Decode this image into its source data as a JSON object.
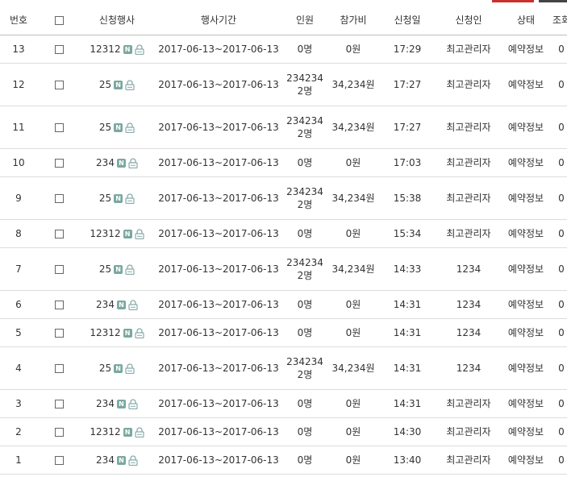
{
  "headers": [
    "번호",
    "",
    "신청행사",
    "행사기간",
    "인원",
    "참가비",
    "신청일",
    "신청인",
    "상태",
    "조회"
  ],
  "rows": [
    {
      "no": "13",
      "event": "12312",
      "period": "2017-06-13~2017-06-13",
      "people": "0명",
      "fee": "0원",
      "date": "17:29",
      "applicant": "최고관리자",
      "status": "예약정보",
      "views": "0"
    },
    {
      "no": "12",
      "event": "25",
      "period": "2017-06-13~2017-06-13",
      "people": "2342342명",
      "fee": "34,234원",
      "date": "17:27",
      "applicant": "최고관리자",
      "status": "예약정보",
      "views": "0"
    },
    {
      "no": "11",
      "event": "25",
      "period": "2017-06-13~2017-06-13",
      "people": "2342342명",
      "fee": "34,234원",
      "date": "17:27",
      "applicant": "최고관리자",
      "status": "예약정보",
      "views": "0"
    },
    {
      "no": "10",
      "event": "234",
      "period": "2017-06-13~2017-06-13",
      "people": "0명",
      "fee": "0원",
      "date": "17:03",
      "applicant": "최고관리자",
      "status": "예약정보",
      "views": "0"
    },
    {
      "no": "9",
      "event": "25",
      "period": "2017-06-13~2017-06-13",
      "people": "2342342명",
      "fee": "34,234원",
      "date": "15:38",
      "applicant": "최고관리자",
      "status": "예약정보",
      "views": "0"
    },
    {
      "no": "8",
      "event": "12312",
      "period": "2017-06-13~2017-06-13",
      "people": "0명",
      "fee": "0원",
      "date": "15:34",
      "applicant": "최고관리자",
      "status": "예약정보",
      "views": "0"
    },
    {
      "no": "7",
      "event": "25",
      "period": "2017-06-13~2017-06-13",
      "people": "2342342명",
      "fee": "34,234원",
      "date": "14:33",
      "applicant": "1234",
      "status": "예약정보",
      "views": "0"
    },
    {
      "no": "6",
      "event": "234",
      "period": "2017-06-13~2017-06-13",
      "people": "0명",
      "fee": "0원",
      "date": "14:31",
      "applicant": "1234",
      "status": "예약정보",
      "views": "0"
    },
    {
      "no": "5",
      "event": "12312",
      "period": "2017-06-13~2017-06-13",
      "people": "0명",
      "fee": "0원",
      "date": "14:31",
      "applicant": "1234",
      "status": "예약정보",
      "views": "0"
    },
    {
      "no": "4",
      "event": "25",
      "period": "2017-06-13~2017-06-13",
      "people": "2342342명",
      "fee": "34,234원",
      "date": "14:31",
      "applicant": "1234",
      "status": "예약정보",
      "views": "0"
    },
    {
      "no": "3",
      "event": "234",
      "period": "2017-06-13~2017-06-13",
      "people": "0명",
      "fee": "0원",
      "date": "14:31",
      "applicant": "최고관리자",
      "status": "예약정보",
      "views": "0"
    },
    {
      "no": "2",
      "event": "12312",
      "period": "2017-06-13~2017-06-13",
      "people": "0명",
      "fee": "0원",
      "date": "14:30",
      "applicant": "최고관리자",
      "status": "예약정보",
      "views": "0"
    },
    {
      "no": "1",
      "event": "234",
      "period": "2017-06-13~2017-06-13",
      "people": "0명",
      "fee": "0원",
      "date": "13:40",
      "applicant": "최고관리자",
      "status": "예약정보",
      "views": "0"
    }
  ],
  "icons": {
    "new_badge": "N",
    "new_icon": "new-badge-icon",
    "lock_icon": "lock-icon"
  }
}
